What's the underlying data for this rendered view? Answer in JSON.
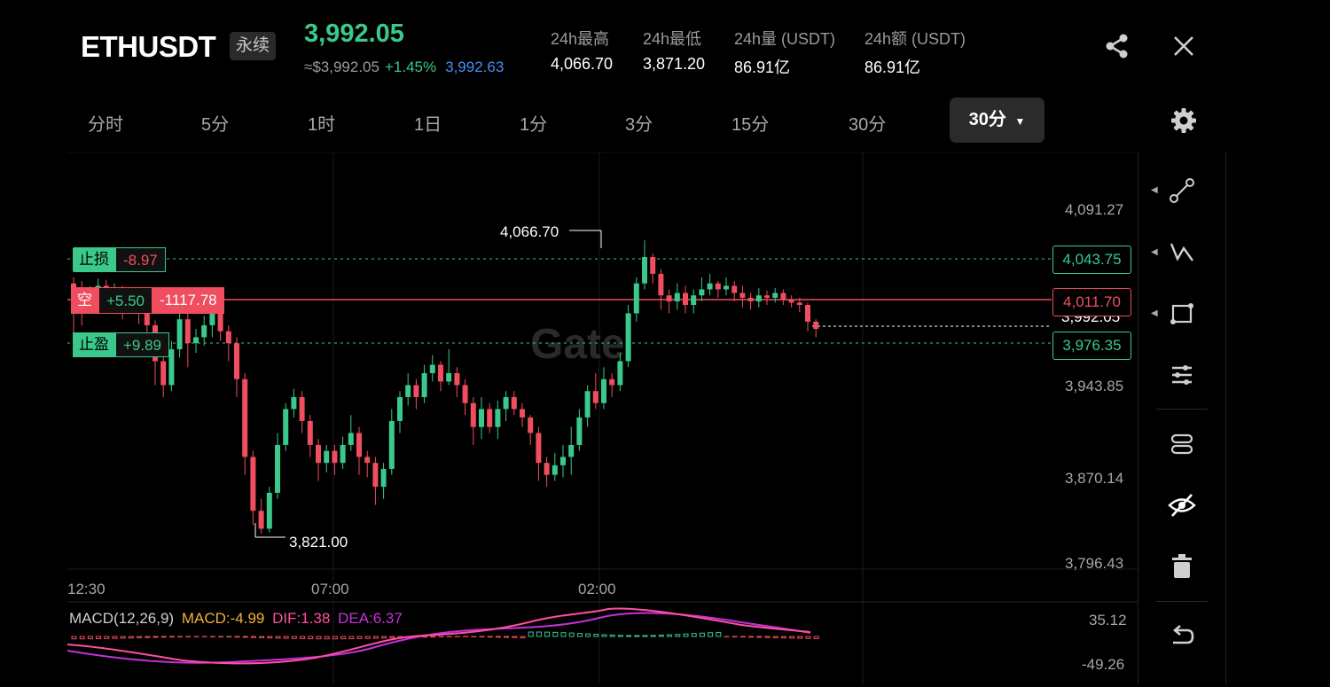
{
  "header": {
    "symbol": "ETHUSDT",
    "contract_type": "永续",
    "last_price": "3,992.05",
    "approx_price": "≈$3,992.05",
    "change_pct": "+1.45%",
    "mark_price": "3,992.63",
    "stats": [
      {
        "label": "24h最高",
        "value": "4,066.70"
      },
      {
        "label": "24h最低",
        "value": "3,871.20"
      },
      {
        "label": "24h量 (USDT)",
        "value": "86.91亿"
      },
      {
        "label": "24h额 (USDT)",
        "value": "86.91亿"
      }
    ]
  },
  "tabs": [
    "分时",
    "5分",
    "1时",
    "1日",
    "1分",
    "3分",
    "15分",
    "30分"
  ],
  "active_interval": "30分",
  "chart_data": {
    "type": "candlestick",
    "y_axis_ticks": [
      "4,091.27",
      "3,943.85",
      "3,870.14",
      "3,796.43"
    ],
    "x_axis_ticks": [
      "12:30",
      "07:00",
      "02:00"
    ],
    "high_marker": "4,066.70",
    "low_marker": "3,821.00",
    "current_price_label": "3,992.05",
    "levels": {
      "stop_loss": {
        "label": "止损",
        "pnl": "-8.97",
        "price": "4,043.75"
      },
      "position": {
        "label": "空",
        "pnl": "+5.50",
        "amount": "-1117.78",
        "price": "4,011.70"
      },
      "take_profit": {
        "label": "止盈",
        "pnl": "+9.89",
        "price": "3,976.35"
      }
    },
    "watermark": "Gate",
    "macd": {
      "label": "MACD(12,26,9)",
      "macd": "MACD:-4.99",
      "dif": "DIF:1.38",
      "dea": "DEA:6.37",
      "y_ticks": [
        "35.12",
        "-49.26"
      ]
    },
    "candles": [
      [
        4030,
        4025,
        4035,
        3985
      ],
      [
        4025,
        4010,
        4032,
        3995
      ],
      [
        4010,
        4020,
        4028,
        4005
      ],
      [
        4020,
        4028,
        4034,
        4012
      ],
      [
        4028,
        4015,
        4033,
        4008
      ],
      [
        4015,
        4022,
        4030,
        4010
      ],
      [
        4022,
        4012,
        4028,
        4000
      ],
      [
        4012,
        4020,
        4026,
        4006
      ],
      [
        4020,
        4010,
        4025,
        3996
      ],
      [
        4010,
        3995,
        4015,
        3985
      ],
      [
        3995,
        3965,
        3999,
        3945
      ],
      [
        3965,
        3945,
        3970,
        3935
      ],
      [
        3945,
        3975,
        3982,
        3940
      ],
      [
        3975,
        4000,
        4008,
        3968
      ],
      [
        4000,
        3980,
        4005,
        3960
      ],
      [
        3980,
        3985,
        3992,
        3972
      ],
      [
        3985,
        3995,
        4003,
        3978
      ],
      [
        3995,
        4005,
        4010,
        3985
      ],
      [
        4005,
        3990,
        4010,
        3982
      ],
      [
        3990,
        3980,
        3995,
        3965
      ],
      [
        3980,
        3950,
        3985,
        3935
      ],
      [
        3950,
        3885,
        3955,
        3870
      ],
      [
        3885,
        3840,
        3890,
        3828
      ],
      [
        3840,
        3825,
        3850,
        3821
      ],
      [
        3825,
        3855,
        3860,
        3822
      ],
      [
        3855,
        3895,
        3905,
        3850
      ],
      [
        3895,
        3925,
        3930,
        3890
      ],
      [
        3925,
        3935,
        3942,
        3918
      ],
      [
        3935,
        3915,
        3940,
        3905
      ],
      [
        3915,
        3895,
        3920,
        3885
      ],
      [
        3895,
        3880,
        3900,
        3865
      ],
      [
        3880,
        3890,
        3895,
        3872
      ],
      [
        3890,
        3880,
        3895,
        3870
      ],
      [
        3880,
        3895,
        3902,
        3875
      ],
      [
        3895,
        3905,
        3920,
        3890
      ],
      [
        3905,
        3885,
        3910,
        3870
      ],
      [
        3885,
        3880,
        3890,
        3868
      ],
      [
        3880,
        3860,
        3885,
        3845
      ],
      [
        3860,
        3875,
        3880,
        3850
      ],
      [
        3875,
        3915,
        3925,
        3870
      ],
      [
        3915,
        3935,
        3940,
        3905
      ],
      [
        3935,
        3945,
        3955,
        3928
      ],
      [
        3945,
        3935,
        3950,
        3925
      ],
      [
        3935,
        3955,
        3962,
        3930
      ],
      [
        3955,
        3962,
        3970,
        3948
      ],
      [
        3962,
        3948,
        3965,
        3940
      ],
      [
        3948,
        3955,
        3975,
        3945
      ],
      [
        3955,
        3945,
        3960,
        3935
      ],
      [
        3945,
        3930,
        3950,
        3920
      ],
      [
        3930,
        3910,
        3935,
        3895
      ],
      [
        3910,
        3925,
        3935,
        3900
      ],
      [
        3925,
        3910,
        3930,
        3905
      ],
      [
        3910,
        3925,
        3932,
        3900
      ],
      [
        3925,
        3935,
        3940,
        3915
      ],
      [
        3935,
        3925,
        3940,
        3920
      ],
      [
        3925,
        3918,
        3930,
        3910
      ],
      [
        3918,
        3905,
        3920,
        3895
      ],
      [
        3905,
        3880,
        3910,
        3865
      ],
      [
        3880,
        3870,
        3885,
        3860
      ],
      [
        3870,
        3878,
        3888,
        3865
      ],
      [
        3878,
        3885,
        3895,
        3868
      ],
      [
        3885,
        3895,
        3910,
        3870
      ],
      [
        3895,
        3918,
        3925,
        3890
      ],
      [
        3918,
        3940,
        3945,
        3910
      ],
      [
        3940,
        3930,
        3955,
        3925
      ],
      [
        3930,
        3950,
        3960,
        3925
      ],
      [
        3950,
        3945,
        3955,
        3935
      ],
      [
        3945,
        3965,
        3972,
        3940
      ],
      [
        3965,
        4005,
        4012,
        3960
      ],
      [
        4005,
        4030,
        4035,
        3998
      ],
      [
        4030,
        4052,
        4066,
        4025
      ],
      [
        4052,
        4038,
        4055,
        4030
      ],
      [
        4038,
        4020,
        4042,
        4008
      ],
      [
        4020,
        4015,
        4025,
        4005
      ],
      [
        4015,
        4022,
        4030,
        4008
      ],
      [
        4022,
        4012,
        4028,
        4005
      ],
      [
        4012,
        4020,
        4025,
        4005
      ],
      [
        4020,
        4025,
        4035,
        4015
      ],
      [
        4025,
        4030,
        4038,
        4020
      ],
      [
        4030,
        4025,
        4032,
        4018
      ],
      [
        4025,
        4028,
        4035,
        4020
      ],
      [
        4028,
        4022,
        4032,
        4015
      ],
      [
        4022,
        4018,
        4028,
        4010
      ],
      [
        4018,
        4015,
        4022,
        4008
      ],
      [
        4015,
        4020,
        4026,
        4010
      ],
      [
        4020,
        4018,
        4024,
        4012
      ],
      [
        4018,
        4022,
        4026,
        4014
      ],
      [
        4022,
        4016,
        4025,
        4012
      ],
      [
        4016,
        4014,
        4020,
        4010
      ],
      [
        4014,
        4012,
        4018,
        4006
      ],
      [
        4012,
        3998,
        4014,
        3990
      ],
      [
        3998,
        3992,
        4000,
        3985
      ]
    ]
  },
  "tools": [
    "trend-line",
    "zigzag",
    "rectangle",
    "settings-sliders",
    "layers",
    "hide",
    "delete",
    "undo"
  ]
}
